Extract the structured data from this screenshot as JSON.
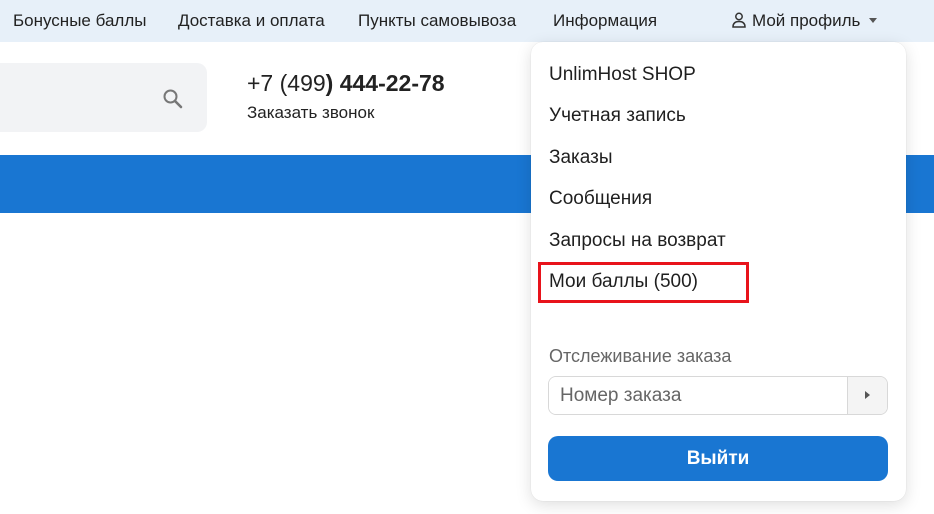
{
  "topnav": {
    "links": [
      "Бонусные баллы",
      "Доставка и оплата",
      "Пункты самовывоза",
      "Информация"
    ],
    "profile_label": "Мой профиль"
  },
  "header": {
    "search_placeholder": "",
    "phone_prefix": "+7 (499",
    "phone_main": ") 444-22-78",
    "callback_label": "Заказать звонок"
  },
  "profile_menu": {
    "items": [
      "UnlimHost SHOP",
      "Учетная запись",
      "Заказы",
      "Сообщения",
      "Запросы на возврат",
      "Мои баллы (500)"
    ],
    "tracking_label": "Отслеживание заказа",
    "order_placeholder": "Номер заказа",
    "logout_label": "Выйти"
  },
  "colors": {
    "accent": "#1976d2",
    "topnav_bg": "#e7f0f9",
    "highlight": "#e8131b"
  }
}
